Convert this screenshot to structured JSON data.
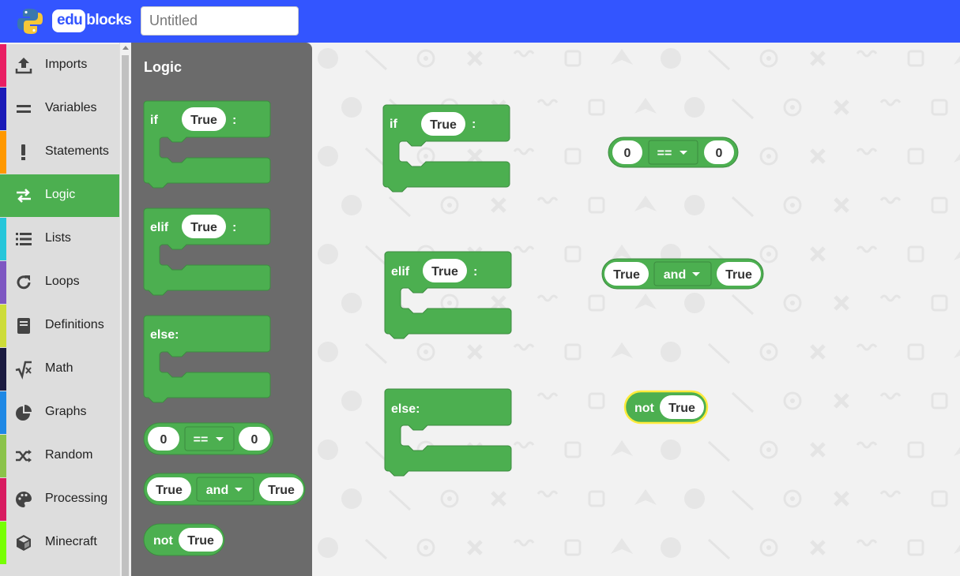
{
  "header": {
    "brand_box": "edu",
    "brand_rest": "blocks",
    "project_placeholder": "Untitled",
    "color": "#3355ff"
  },
  "toolbox": {
    "categories": [
      {
        "label": "Imports",
        "icon": "upload-icon",
        "color": "#e91e63"
      },
      {
        "label": "Variables",
        "icon": "equals-icon",
        "color": "#1a1ab8"
      },
      {
        "label": "Statements",
        "icon": "exclamation-icon",
        "color": "#ff9800"
      },
      {
        "label": "Logic",
        "icon": "swap-arrows-icon",
        "color": "#4caf50"
      },
      {
        "label": "Lists",
        "icon": "list-icon",
        "color": "#26c6da"
      },
      {
        "label": "Loops",
        "icon": "redo-icon",
        "color": "#7e57c2"
      },
      {
        "label": "Definitions",
        "icon": "book-icon",
        "color": "#cddc39"
      },
      {
        "label": "Math",
        "icon": "square-root-icon",
        "color": "#1a1a40"
      },
      {
        "label": "Graphs",
        "icon": "pie-chart-icon",
        "color": "#1e88e5"
      },
      {
        "label": "Random",
        "icon": "shuffle-icon",
        "color": "#8bc34a"
      },
      {
        "label": "Processing",
        "icon": "palette-icon",
        "color": "#d81b60"
      },
      {
        "label": "Minecraft",
        "icon": "cube-icon",
        "color": "#76ff03"
      }
    ],
    "selected": "Logic"
  },
  "flyout": {
    "title": "Logic"
  },
  "blocks": {
    "if_kw": "if",
    "elif_kw": "elif",
    "else_kw": "else:",
    "colon": ":",
    "true_val": "True",
    "zero_val": "0",
    "eq_op": "==",
    "and_op": "and",
    "not_kw": "not",
    "block_color": "#4caf50",
    "selected_outline": "#ffeb3b"
  }
}
